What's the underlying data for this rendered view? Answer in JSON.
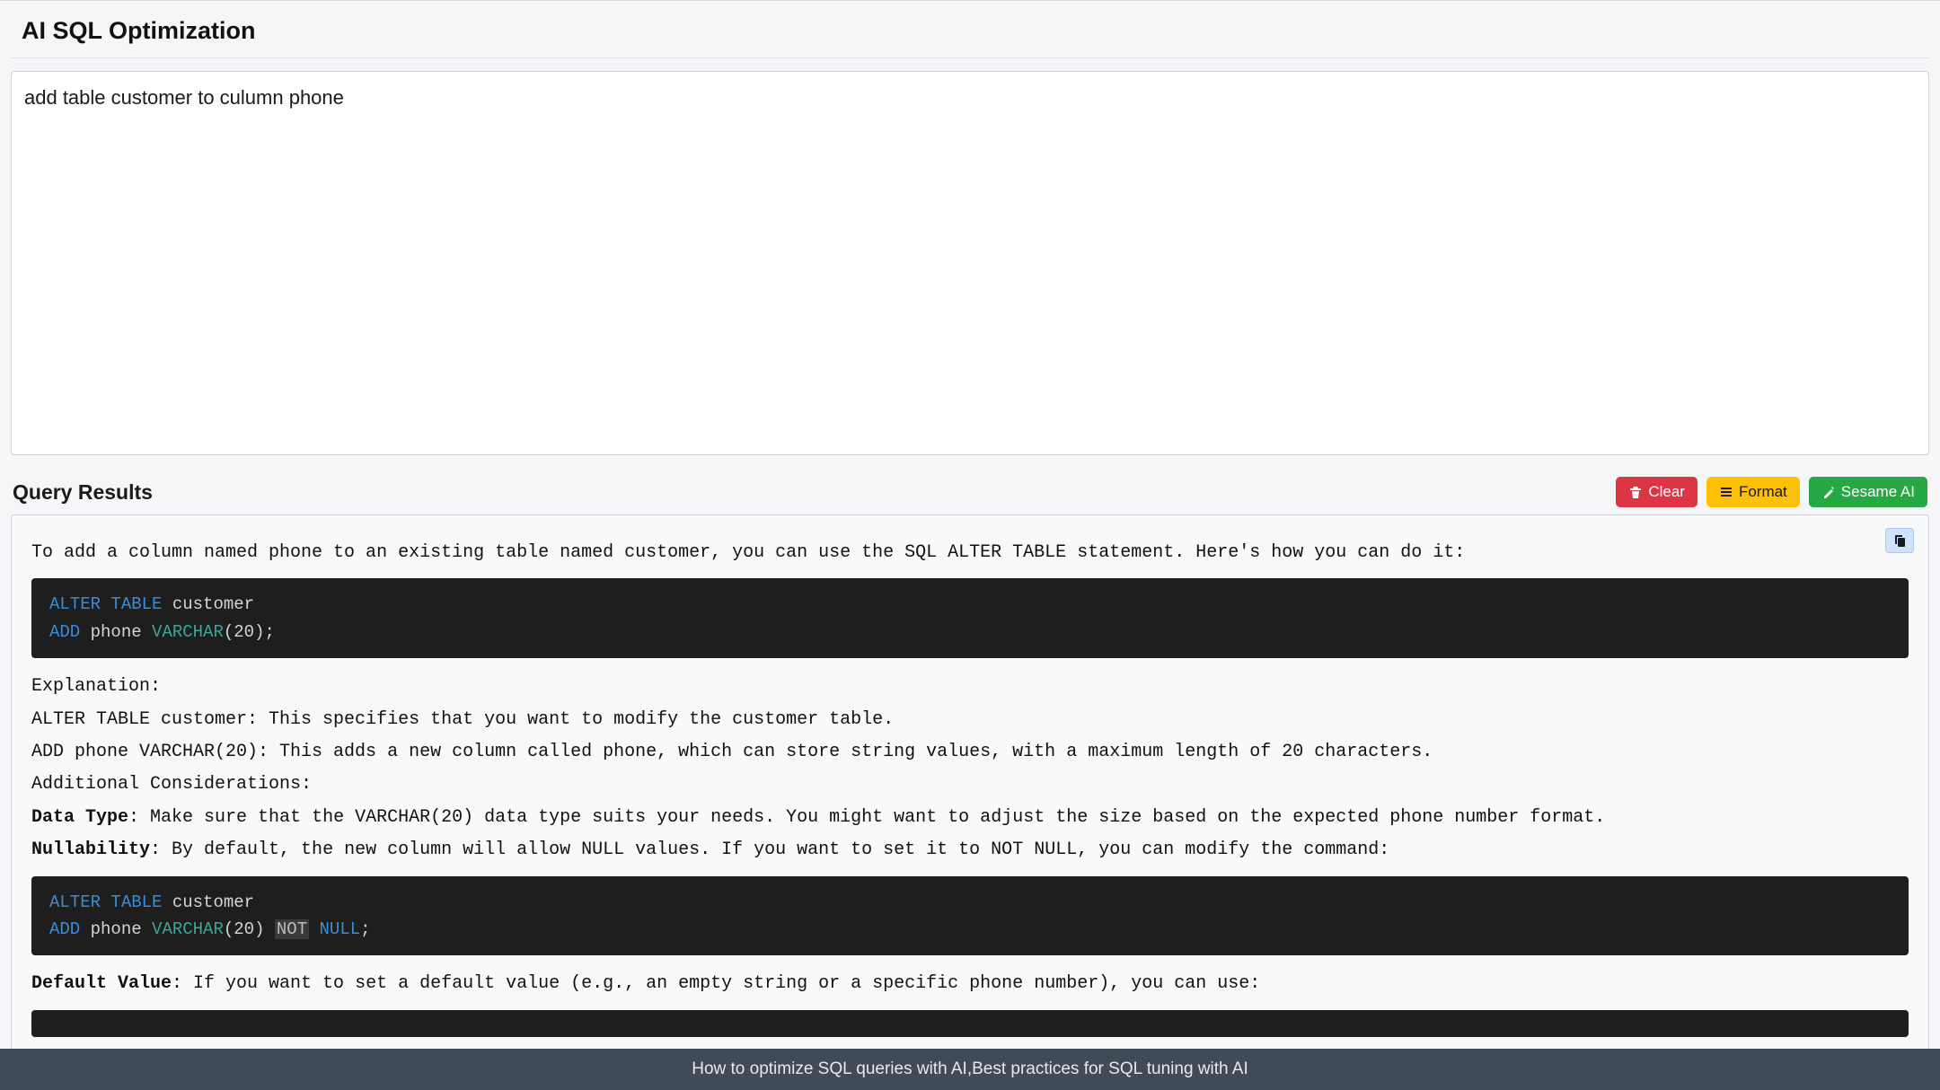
{
  "header": {
    "title": "AI SQL Optimization"
  },
  "query": {
    "text": "add table customer to culumn phone"
  },
  "results": {
    "title": "Query Results",
    "buttons": {
      "clear": "Clear",
      "format": "Format",
      "ai": "Sesame AI"
    },
    "intro": "To add a column named phone to an existing table named customer, you can use the SQL ALTER TABLE statement. Here's how you can do it:",
    "code1": {
      "kw_alter": "ALTER",
      "kw_table": "TABLE",
      "tbl": " customer",
      "kw_add": "ADD",
      "col": " phone ",
      "kw_type": "VARCHAR",
      "tail": "(20);"
    },
    "explain_head": "Explanation:",
    "explain_line1": "ALTER TABLE customer: This specifies that you want to modify the customer table.",
    "explain_line2": "ADD phone VARCHAR(20): This adds a new column called phone, which can store string values, with a maximum length of 20 characters.",
    "considerations_head": "Additional Considerations:",
    "datatype_label": "Data Type",
    "datatype_text": ": Make sure that the VARCHAR(20) data type suits your needs. You might want to adjust the size based on the expected phone number format.",
    "null_label": "Nullability",
    "null_text": ": By default, the new column will allow NULL values. If you want to set it to NOT NULL, you can modify the command:",
    "code2": {
      "kw_alter": "ALTER",
      "kw_table": "TABLE",
      "tbl": " customer",
      "kw_add": "ADD",
      "col": " phone ",
      "kw_type": "VARCHAR",
      "size": "(20) ",
      "kw_not": "NOT",
      "sp": " ",
      "kw_null": "NULL",
      "tail": ";"
    },
    "default_label": "Default Value",
    "default_text": ": If you want to set a default value (e.g., an empty string or a specific phone number), you can use:"
  },
  "footer": {
    "text": "How to optimize SQL queries with AI,Best practices for SQL tuning with AI"
  }
}
